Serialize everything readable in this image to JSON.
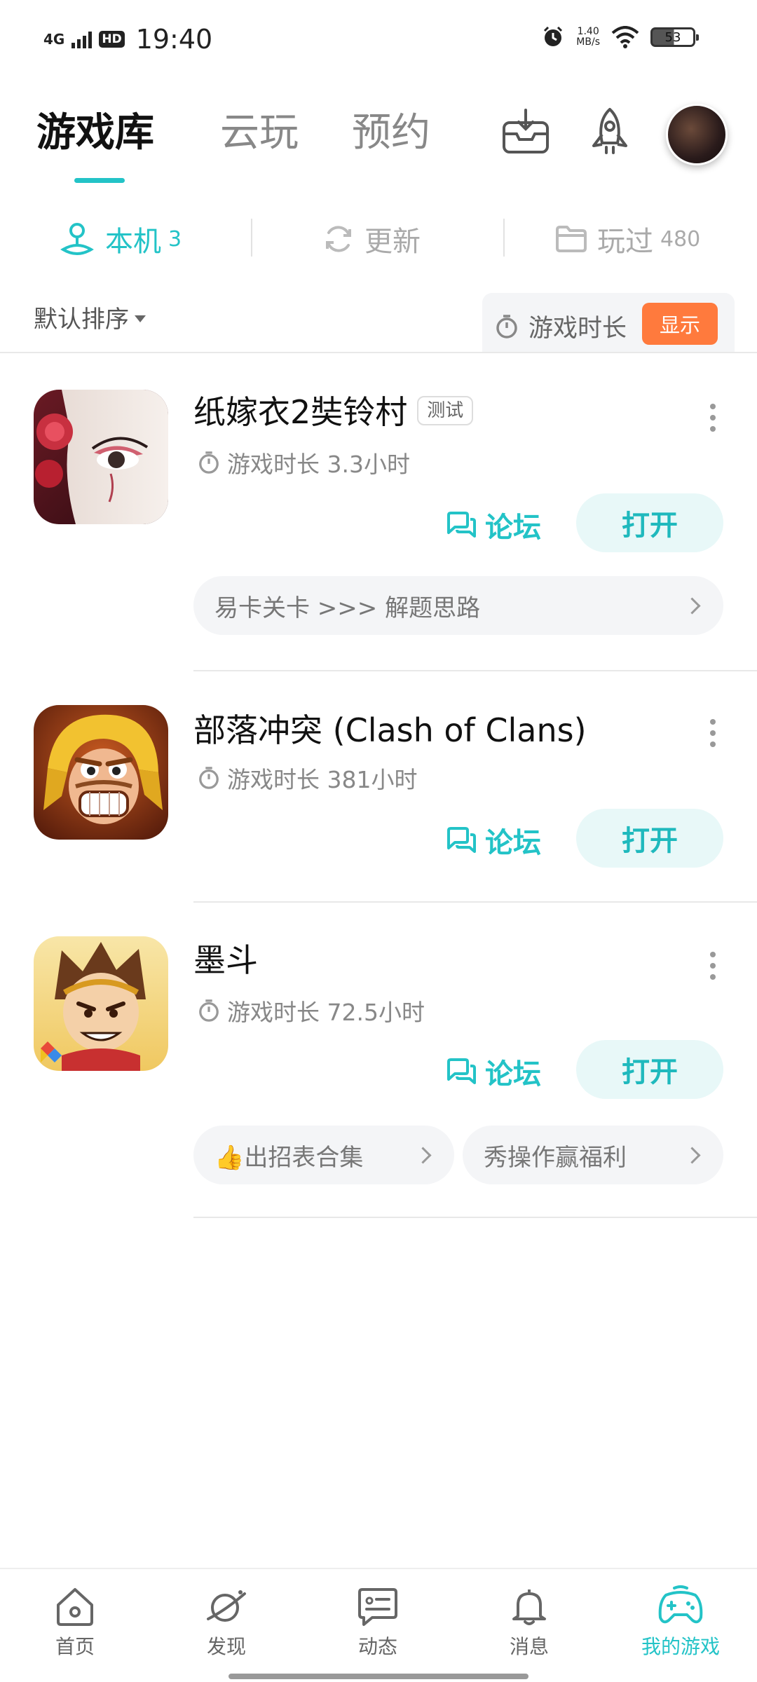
{
  "status": {
    "network": "4G",
    "hd": "HD",
    "time": "19:40",
    "speed_value": "1.40",
    "speed_unit": "MB/s",
    "battery": "53"
  },
  "top_tabs": [
    {
      "label": "游戏库",
      "active": true
    },
    {
      "label": "云玩",
      "active": false
    },
    {
      "label": "预约",
      "active": false
    }
  ],
  "top_icons": [
    "download-box-icon",
    "rocket-icon",
    "avatar"
  ],
  "sub_tabs": [
    {
      "label": "本机",
      "count": "3",
      "icon": "user-icon",
      "active": true
    },
    {
      "label": "更新",
      "count": "",
      "icon": "refresh-icon",
      "active": false
    },
    {
      "label": "玩过",
      "count": "480",
      "icon": "folder-icon",
      "active": false
    }
  ],
  "sort": {
    "label": "默认排序"
  },
  "duration_toggle": {
    "label": "游戏时长",
    "button": "显示"
  },
  "games": [
    {
      "title": "纸嫁衣2奘铃村",
      "tag": "测试",
      "playtime": "游戏时长 3.3小时",
      "forum": "论坛",
      "open": "打开",
      "hints": [
        "易卡关卡 >>> 解题思路"
      ]
    },
    {
      "title": "部落冲突 (Clash of Clans)",
      "tag": "",
      "playtime": "游戏时长 381小时",
      "forum": "论坛",
      "open": "打开",
      "hints": []
    },
    {
      "title": "墨斗",
      "tag": "",
      "playtime": "游戏时长 72.5小时",
      "forum": "论坛",
      "open": "打开",
      "hints": [
        "👍出招表合集",
        "秀操作赢福利"
      ]
    }
  ],
  "bottom_nav": [
    {
      "label": "首页",
      "icon": "home-icon",
      "active": false
    },
    {
      "label": "发现",
      "icon": "planet-icon",
      "active": false
    },
    {
      "label": "动态",
      "icon": "message-card-icon",
      "active": false
    },
    {
      "label": "消息",
      "icon": "bell-icon",
      "active": false
    },
    {
      "label": "我的游戏",
      "icon": "gamepad-icon",
      "active": true
    }
  ],
  "colors": {
    "accent": "#23c3c7",
    "orange": "#ff7a3d"
  }
}
